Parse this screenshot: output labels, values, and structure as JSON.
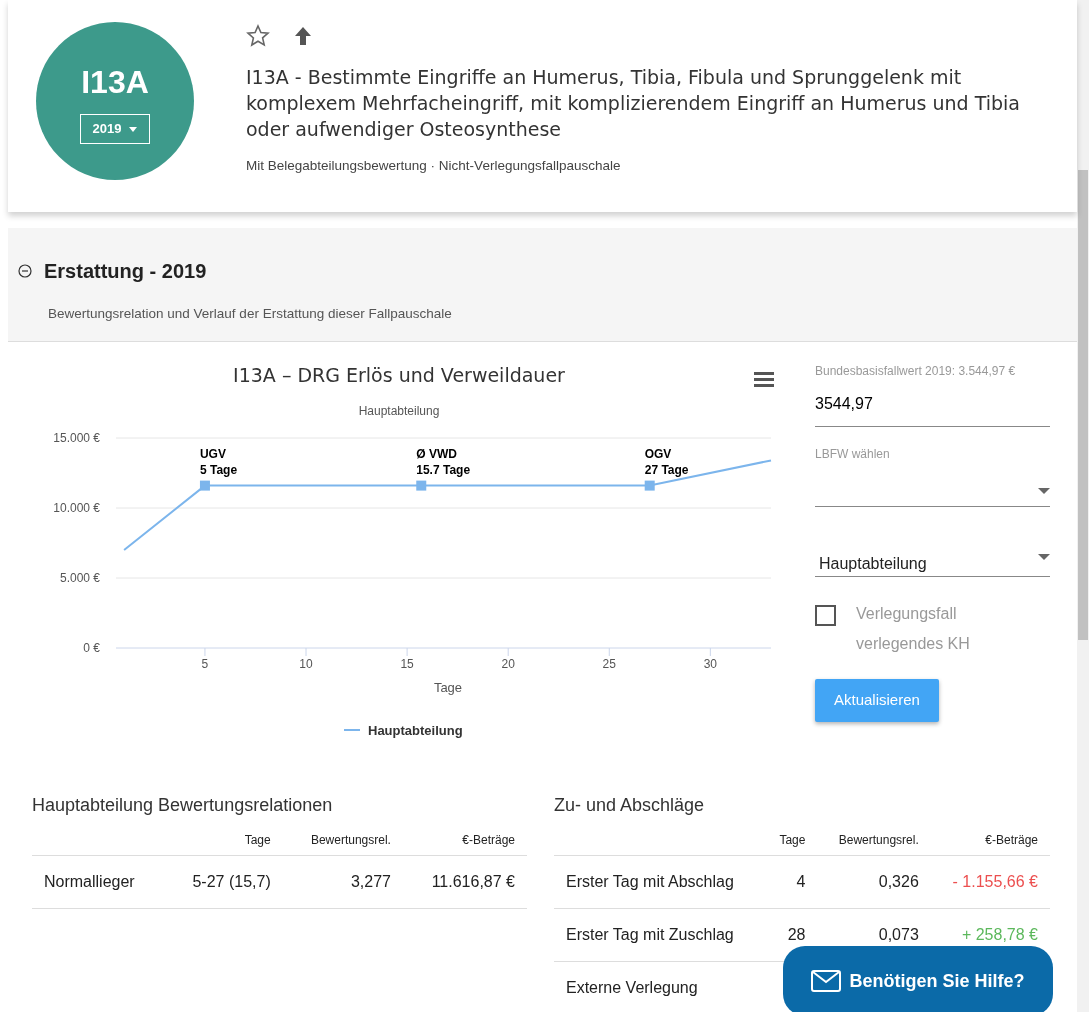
{
  "drg": {
    "code": "I13A",
    "year": "2019",
    "title": "I13A - Bestimmte Eingriffe an Humerus, Tibia, Fibula und Sprunggelenk mit komplexem Mehrfacheingriff, mit komplizierendem Eingriff an Humerus und Tibia oder aufwendiger Osteosynthese",
    "meta": "Mit Belegabteilungsbewertung · Nicht-Verlegungsfallpauschale",
    "favorite": false
  },
  "section": {
    "title": "Erstattung - 2019",
    "subtitle": "Bewertungsrelation und Verlauf der Erstattung dieser Fallpauschale",
    "expanded": true
  },
  "chart": {
    "subtitle": "Hauptabteilung",
    "chart_data": {
      "type": "line",
      "title": "I13A – DRG Erlös und Verweildauer",
      "xlabel": "Tage",
      "x": [
        1,
        5,
        15.7,
        27,
        33
      ],
      "series": [
        {
          "name": "Hauptabteilung",
          "color": "#7cb5ec",
          "values": [
            7000,
            11600,
            11600,
            11600,
            13400
          ]
        }
      ],
      "xlim": [
        0.6,
        33
      ],
      "ylim": [
        0,
        15000
      ],
      "xticks": [
        5,
        10,
        15,
        20,
        25,
        30
      ],
      "yticks": [
        {
          "value": 0,
          "label": "0 €"
        },
        {
          "value": 5000,
          "label": "5.000 €"
        },
        {
          "value": 10000,
          "label": "10.000 €"
        },
        {
          "value": 15000,
          "label": "15.000 €"
        }
      ],
      "annotations": [
        {
          "text": "UGV\n5 Tage"
        },
        {
          "text": "Ø VWD\n15.7 Tage"
        },
        {
          "text": "OGV\n27 Tage"
        }
      ]
    }
  },
  "form": {
    "base_label": "Bundesbasisfallwert 2019: 3.544,97 €",
    "base_value": "3544,97",
    "lbfw_label": "LBFW wählen",
    "department": "Hauptabteilung",
    "transfer_label": "Verlegungsfall verlegendes KH",
    "transfer_checked": false,
    "button": "Aktualisieren"
  },
  "main_table": {
    "title": "Hauptabteilung Bewertungsrelationen",
    "columns": [
      "Tage",
      "Bewertungsrel.",
      "€-Beträge"
    ],
    "rows": [
      {
        "label": "Normallieger",
        "cells": [
          "5-27 (15,7)",
          "3,277",
          "11.616,87 €"
        ]
      }
    ]
  },
  "adjust_table": {
    "title": "Zu- und Abschläge",
    "columns": [
      "Tage",
      "Bewertungsrel.",
      "€-Beträge"
    ],
    "rows": [
      {
        "label": "Erster Tag mit Abschlag",
        "cells": [
          "4",
          "0,326",
          "- 1.155,66 €"
        ],
        "color": "#ec4f4f"
      },
      {
        "label": "Erster Tag mit Zuschlag",
        "cells": [
          "28",
          "0,073",
          "+ 258,78 €"
        ],
        "color": "#5cb85c"
      },
      {
        "label": "Externe Verlegung",
        "cells": []
      }
    ]
  },
  "help_button": "Benötigen Sie Hilfe?"
}
